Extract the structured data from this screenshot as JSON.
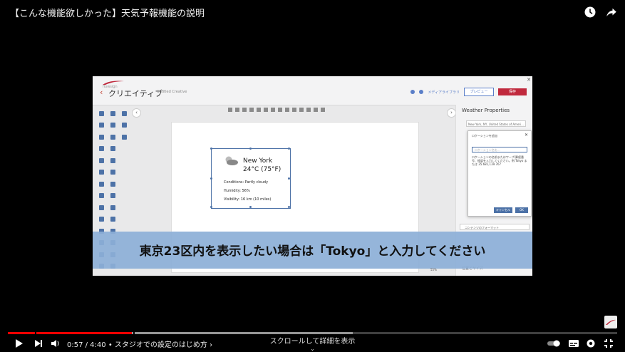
{
  "video_title": "【こんな機能欲しかった】天気予報機能の説明",
  "app": {
    "logo_text": "flowsign",
    "name": "クリエイティブ",
    "doc_title": "Untitled Creative",
    "media_label": "メディアライブラリ",
    "preview_label": "プレビュー",
    "save_label": "保存"
  },
  "weather": {
    "city": "New York",
    "temp": "24°C (75°F)",
    "conditions": "Conditions: Partly cloudy",
    "humidity": "Humidity: 56%",
    "visibility": "Visibility: 16 km (10 miles)"
  },
  "right_panel": {
    "title": "Weather Properties",
    "location_value": "New York, NY, United States of Ameri...",
    "content_format": "コンテンツのフォーマット",
    "size_label": "位置とサイズ"
  },
  "dialog": {
    "title": "ロケーションを追加",
    "placeholder": "ロケーション名を…",
    "help_text": "ロケーションの名前またはワープ/郵便番号、経度を入力してください。例:Tokyo または 35.681,139.767",
    "cancel_label": "キャンセル",
    "ok_label": "OK"
  },
  "subtitle_caption": "東京23区内を表示したい場合は「Tokyo」と入力してください",
  "zoom_level": "55%",
  "player": {
    "current_time": "0:57",
    "duration": "4:40",
    "time_display": "0:57 / 4:40 • スタジオでの設定のはじめ方 ›",
    "scroll_hint": "スクロールして詳細を表示",
    "progress_fraction": 0.2036
  },
  "colors": {
    "accent_blue": "#4d72a7",
    "brand_red": "#c0293d",
    "progress_red": "#ff0000",
    "subtitle_band": "#8cafd7"
  },
  "icons": {
    "top": [
      "clock-icon",
      "share-icon"
    ],
    "controls": [
      "play-icon",
      "next-icon",
      "volume-icon",
      "autoplay-toggle-icon",
      "subtitles-icon",
      "settings-icon",
      "exit-fullscreen-icon"
    ]
  }
}
